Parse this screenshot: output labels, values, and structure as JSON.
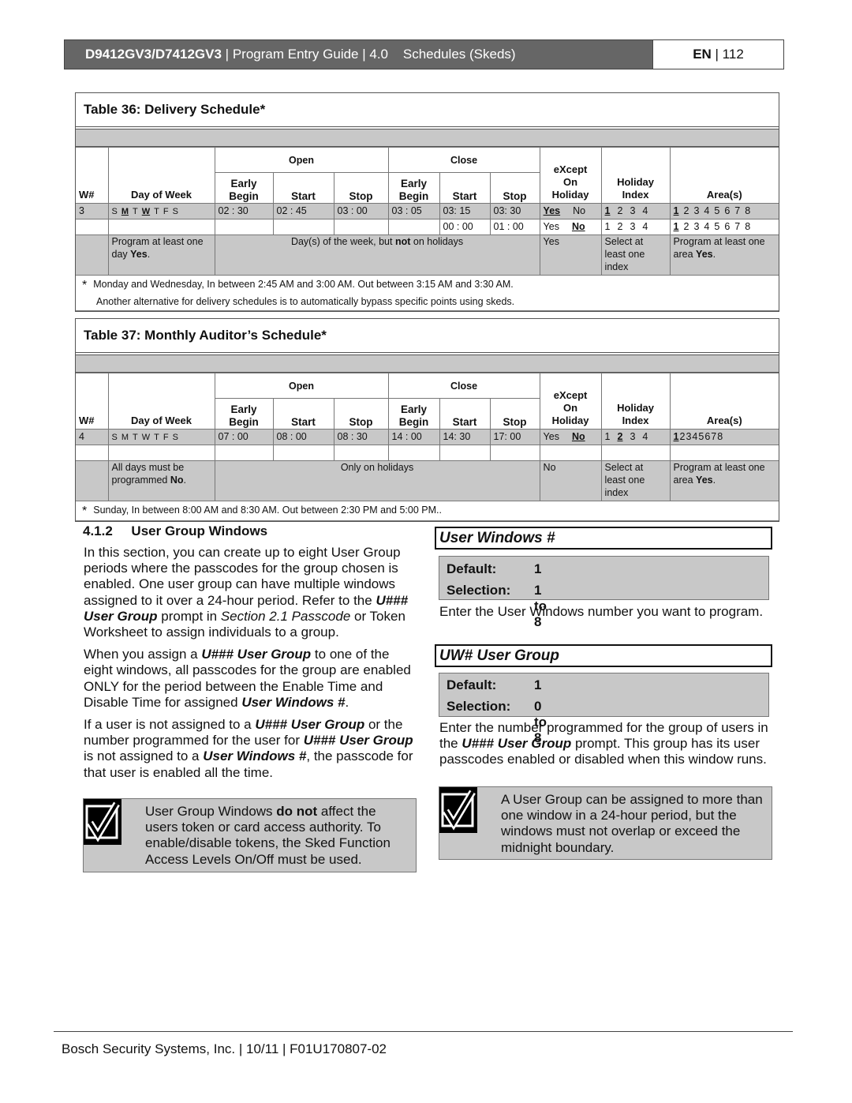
{
  "header": {
    "model": "D9412GV3/D7412GV3",
    "sep": " | ",
    "rest": "Program Entry Guide | 4.0    Schedules (Skeds)",
    "lang": "EN",
    "page": "| 112"
  },
  "table_headers": {
    "w": "W#",
    "day": "Day of Week",
    "open": "Open",
    "close": "Close",
    "early_begin": "Early Begin",
    "start": "Start",
    "stop": "Stop",
    "except": "eXcept On Holiday",
    "holiday": "Holiday Index",
    "areas": "Area(s)"
  },
  "table36": {
    "title": "Table 36: Delivery Schedule*",
    "w": "3",
    "days": [
      {
        "d": "S",
        "u": false
      },
      {
        "d": "M",
        "u": true
      },
      {
        "d": "T",
        "u": false
      },
      {
        "d": "W",
        "u": true
      },
      {
        "d": "T",
        "u": false
      },
      {
        "d": "F",
        "u": false
      },
      {
        "d": "S",
        "u": false
      }
    ],
    "row1": {
      "open_early": "02 : 30",
      "open_start": "02 : 45",
      "open_stop": "03 : 00",
      "close_early": "03 : 05",
      "close_start": "03: 15",
      "close_stop": "03: 30",
      "except": [
        {
          "t": "Yes",
          "u": true
        },
        {
          "t": "No",
          "u": false
        }
      ],
      "holiday": [
        {
          "t": "1",
          "u": true
        },
        {
          "t": "2",
          "u": false
        },
        {
          "t": "3",
          "u": false
        },
        {
          "t": "4",
          "u": false
        }
      ],
      "areas": [
        {
          "t": "1",
          "u": true
        },
        {
          "t": "2",
          "u": false
        },
        {
          "t": "3",
          "u": false
        },
        {
          "t": "4",
          "u": false
        },
        {
          "t": "5",
          "u": false
        },
        {
          "t": "6",
          "u": false
        },
        {
          "t": "7",
          "u": false
        },
        {
          "t": "8",
          "u": false
        }
      ]
    },
    "row2": {
      "close_start": "00 : 00",
      "close_stop": "01 : 00",
      "except": [
        {
          "t": "Yes",
          "u": false
        },
        {
          "t": "No",
          "u": true
        }
      ],
      "holiday": [
        {
          "t": "1",
          "u": false
        },
        {
          "t": "2",
          "u": false
        },
        {
          "t": "3",
          "u": false
        },
        {
          "t": "4",
          "u": false
        }
      ],
      "areas": [
        {
          "t": "1",
          "u": true
        },
        {
          "t": "2",
          "u": false
        },
        {
          "t": "3",
          "u": false
        },
        {
          "t": "4",
          "u": false
        },
        {
          "t": "5",
          "u": false
        },
        {
          "t": "6",
          "u": false
        },
        {
          "t": "7",
          "u": false
        },
        {
          "t": "8",
          "u": false
        }
      ]
    },
    "note": {
      "day": [
        {
          "t": "Program at least one day "
        },
        {
          "t": "Yes",
          "b": true
        },
        {
          "t": "."
        }
      ],
      "times": [
        {
          "t": "Day(s) of the week, but "
        },
        {
          "t": "not",
          "b": true
        },
        {
          "t": " on holidays"
        }
      ],
      "except": "Yes",
      "holiday": "Select at least one index",
      "areas": [
        {
          "t": "Program at least one area "
        },
        {
          "t": "Yes",
          "b": true
        },
        {
          "t": "."
        }
      ]
    },
    "footnote_star": "*",
    "footnote1": "Monday and Wednesday, In between 2:45 AM and 3:00 AM. Out between 3:15 AM and 3:30 AM.",
    "footnote2": "Another alternative for delivery schedules is to automatically bypass specific points using skeds."
  },
  "table37": {
    "title": "Table 37: Monthly Auditor’s Schedule*",
    "w": "4",
    "days": [
      {
        "d": "S",
        "u": false
      },
      {
        "d": "M",
        "u": false
      },
      {
        "d": "T",
        "u": false
      },
      {
        "d": "W",
        "u": false
      },
      {
        "d": "T",
        "u": false
      },
      {
        "d": "F",
        "u": false
      },
      {
        "d": "S",
        "u": false
      }
    ],
    "row1": {
      "open_early": "07 : 00",
      "open_start": "08 : 00",
      "open_stop": "08 : 30",
      "close_early": "14 : 00",
      "close_start": "14: 30",
      "close_stop": "17: 00",
      "except": [
        {
          "t": "Yes",
          "u": false
        },
        {
          "t": "No",
          "u": true
        }
      ],
      "holiday": [
        {
          "t": "1",
          "u": false
        },
        {
          "t": "2",
          "u": true
        },
        {
          "t": "3",
          "u": false
        },
        {
          "t": "4",
          "u": false
        }
      ],
      "areas": [
        {
          "t": "1",
          "u": true
        },
        {
          "t": "2",
          "u": false
        },
        {
          "t": "3",
          "u": false
        },
        {
          "t": "4",
          "u": false
        },
        {
          "t": "5",
          "u": false
        },
        {
          "t": "6",
          "u": false
        },
        {
          "t": "7",
          "u": false
        },
        {
          "t": "8",
          "u": false
        }
      ]
    },
    "note": {
      "day": [
        {
          "t": "All days must be programmed "
        },
        {
          "t": "No",
          "b": true
        },
        {
          "t": "."
        }
      ],
      "times": [
        {
          "t": "Only on holidays"
        }
      ],
      "except": "No",
      "holiday": "Select at least one index",
      "areas": [
        {
          "t": "Program at least one area "
        },
        {
          "t": "Yes",
          "b": true
        },
        {
          "t": "."
        }
      ]
    },
    "footnote_star": "*",
    "footnote1": "Sunday, In between 8:00 AM and 8:30 AM. Out between 2:30 PM and 5:00 PM.."
  },
  "section": {
    "heading": "4.1.2     User Group Windows",
    "paragraphs": [
      [
        {
          "t": "In this section, you can create up to eight User Group periods where the passcodes for the group chosen is enabled. One user group can have multiple windows assigned to it over a 24-hour period. Refer to the "
        },
        {
          "t": "U### User Group",
          "b": true,
          "i": true
        },
        {
          "t": " prompt in "
        },
        {
          "t": "Section 2.1 Passcode",
          "i": true
        },
        {
          "t": " or Token Worksheet to assign individuals to a group."
        }
      ],
      [
        {
          "t": "When you assign a "
        },
        {
          "t": "U### User Group",
          "b": true,
          "i": true
        },
        {
          "t": " to one of the eight windows, all passcodes for the group are enabled ONLY for the period between the Enable Time and Disable Time for assigned "
        },
        {
          "t": "User Windows #",
          "b": true,
          "i": true
        },
        {
          "t": "."
        }
      ],
      [
        {
          "t": "If a user is not assigned to a "
        },
        {
          "t": "U### User Group",
          "b": true,
          "i": true
        },
        {
          "t": " or the number programmed for the user for "
        },
        {
          "t": "U### User Group",
          "b": true,
          "i": true
        },
        {
          "t": " is not assigned to a "
        },
        {
          "t": "User Windows #",
          "b": true,
          "i": true
        },
        {
          "t": ", the passcode for that user is enabled all the time."
        }
      ]
    ],
    "note": [
      {
        "t": "User Group Windows "
      },
      {
        "t": "do not",
        "b": true
      },
      {
        "t": " affect the users token or card access authority. To enable/disable tokens, the Sked Function Access Levels On/Off must be used."
      }
    ]
  },
  "prompts": [
    {
      "title": "User Windows #",
      "default_label": "Default:",
      "default_value": "1",
      "selection_label": "Selection:",
      "selection_value": "1 to 8",
      "desc": "Enter the User Windows number you want to program."
    },
    {
      "title": "UW# User Group",
      "default_label": "Default:",
      "default_value": "1",
      "selection_label": "Selection:",
      "selection_value": "0 to 8",
      "desc_rich": [
        {
          "t": "Enter the number programmed for the group of users in the "
        },
        {
          "t": "U### User Group",
          "b": true,
          "i": true
        },
        {
          "t": " prompt. This group has its user passcodes enabled or disabled when this window runs."
        }
      ],
      "note": "A User Group can be assigned to more than one window in a 24-hour period, but the windows must not overlap or exceed the midnight boundary."
    }
  ],
  "footer": "Bosch Security Systems, Inc. | 10/11 | F01U170807-02",
  "colors": {
    "header_bg": "#666666",
    "band": "#c8c8c8"
  },
  "icons": {
    "note": "checkbox-check-icon"
  }
}
